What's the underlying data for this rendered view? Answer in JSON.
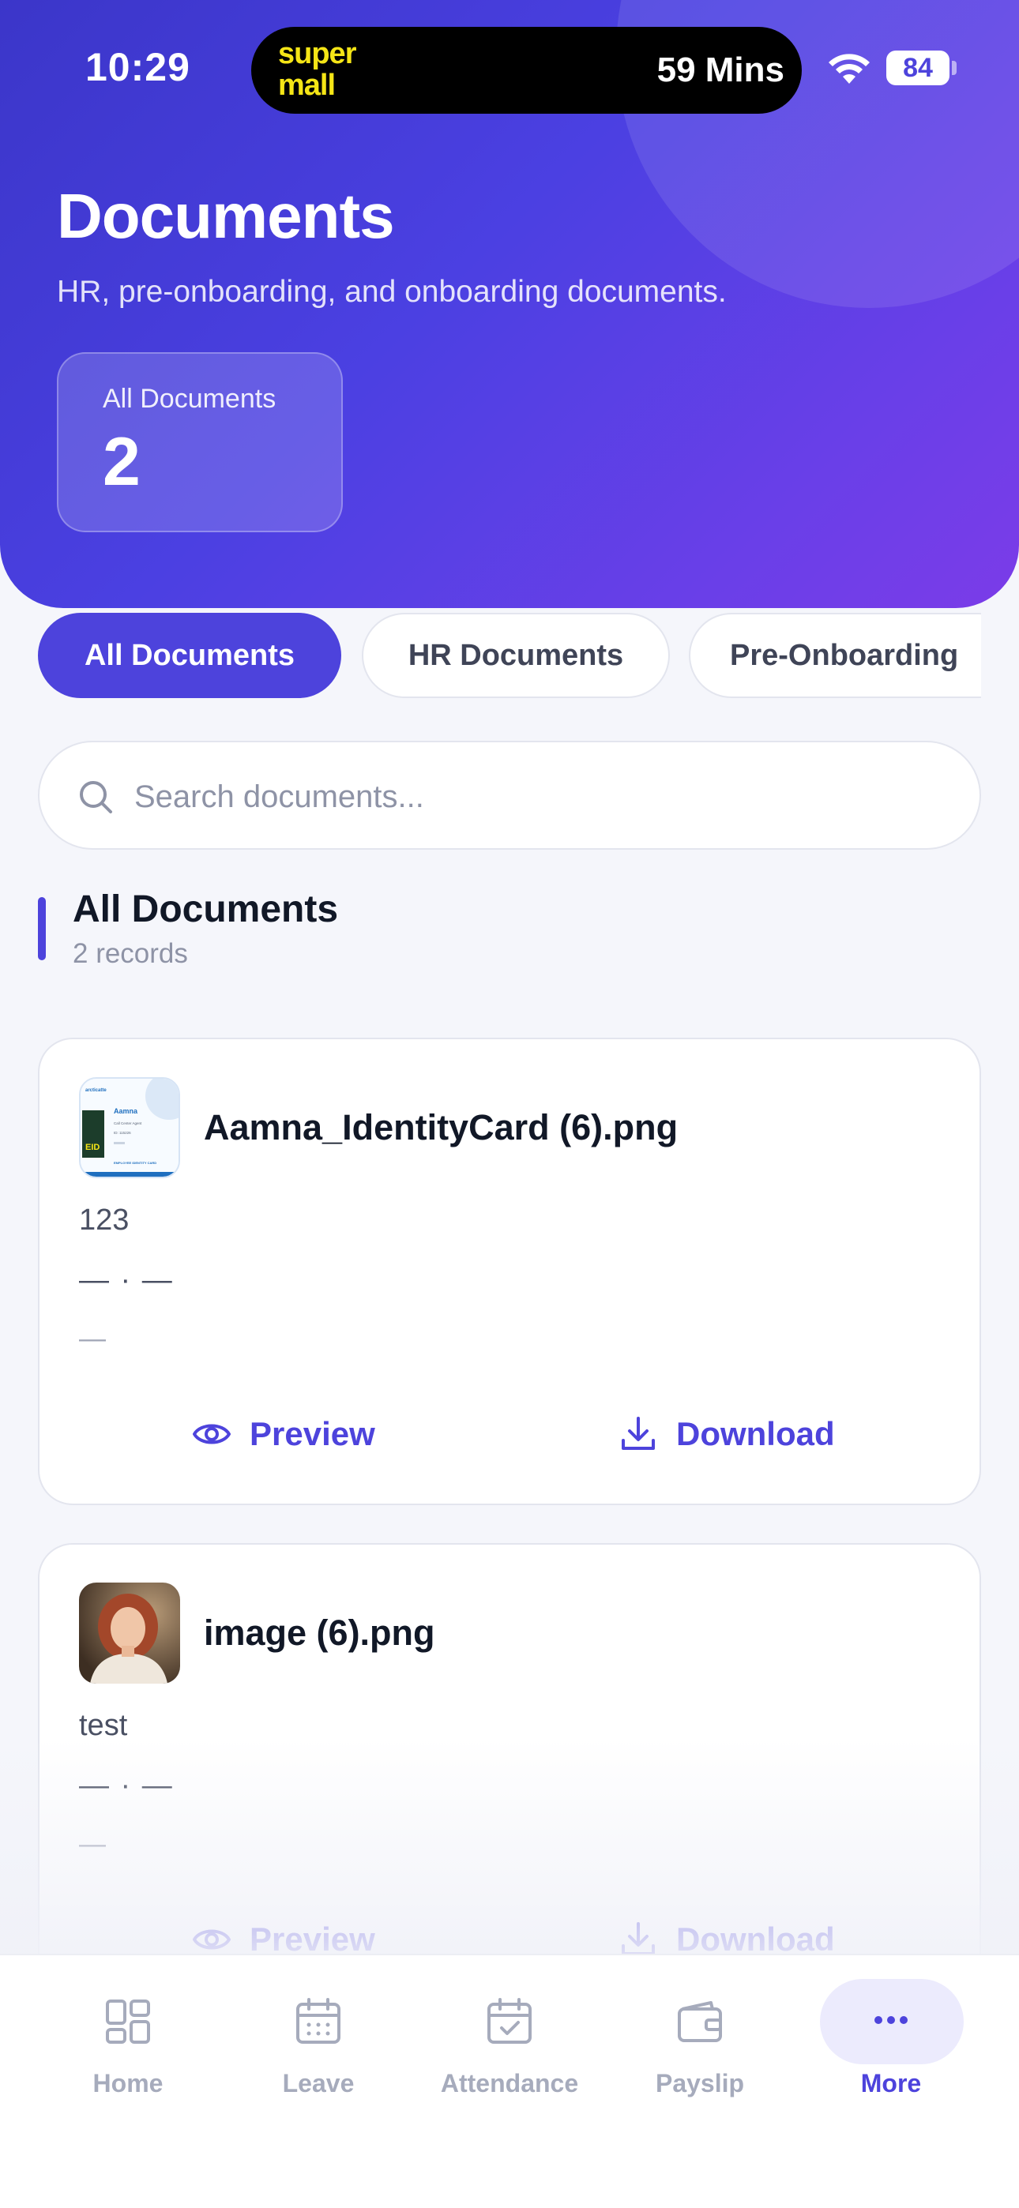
{
  "status_bar": {
    "time": "10:29",
    "island_logo_line1": "super",
    "island_logo_line2": "mall",
    "island_text": "59 Mins",
    "battery": "84"
  },
  "header": {
    "title": "Documents",
    "subtitle": "HR, pre-onboarding, and onboarding documents.",
    "stat_label": "All Documents",
    "stat_value": "2"
  },
  "filters": [
    {
      "label": "All Documents",
      "active": true
    },
    {
      "label": "HR Documents",
      "active": false
    },
    {
      "label": "Pre-Onboarding",
      "active": false
    }
  ],
  "search": {
    "placeholder": "Search documents..."
  },
  "section": {
    "title": "All Documents",
    "subtitle": "2 records"
  },
  "documents": [
    {
      "name": "Aamna_IdentityCard (6).png",
      "description": "123",
      "meta": "— · —",
      "meta2": "—",
      "preview_label": "Preview",
      "download_label": "Download",
      "thumb": {
        "brand": "arcticatte",
        "person": "Aamna",
        "role": "Call Center Agent",
        "id": "ID: 115226",
        "badge": "EID",
        "footer": "EMPLOYEE IDENTITY CARD"
      }
    },
    {
      "name": "image (6).png",
      "description": "test",
      "meta": "— · —",
      "meta2": "—",
      "preview_label": "Preview",
      "download_label": "Download"
    }
  ],
  "tabbar": [
    {
      "label": "Home",
      "icon": "grid-icon"
    },
    {
      "label": "Leave",
      "icon": "calendar-icon"
    },
    {
      "label": "Attendance",
      "icon": "calendar-check-icon"
    },
    {
      "label": "Payslip",
      "icon": "wallet-icon"
    },
    {
      "label": "More",
      "icon": "more-icon",
      "active": true
    }
  ],
  "colors": {
    "accent": "#4d43dc",
    "header_start": "#3b36c9",
    "header_end": "#7b3ce8"
  }
}
